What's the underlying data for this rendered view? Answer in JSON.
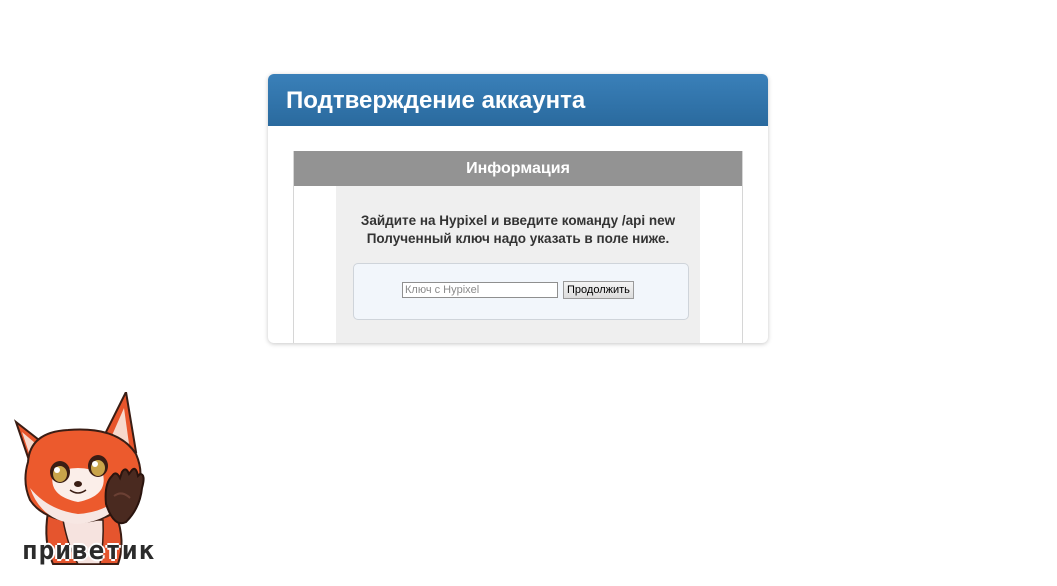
{
  "panel": {
    "title": "Подтверждение аккаунта",
    "accent_color": "#2e72a8"
  },
  "info": {
    "title": "Информация",
    "instruction_line1": "Зайдите на Hypixel и введите команду /api new",
    "instruction_line2": "Полученный ключ надо указать в поле ниже.",
    "key_input": {
      "value": "",
      "placeholder": "Ключ с Hypixel"
    },
    "continue_label": "Продолжить"
  },
  "sticker": {
    "icon": "fox-waving-sticker",
    "caption": "приветик"
  }
}
